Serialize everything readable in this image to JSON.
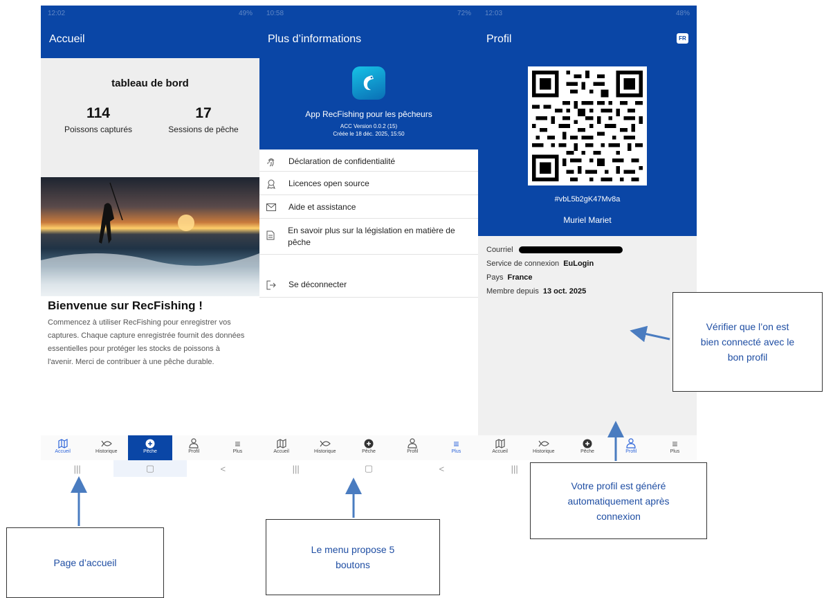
{
  "screen1": {
    "status_time": "12:02",
    "status_right": "49%",
    "title": "Accueil",
    "dashboard": {
      "title": "tableau de bord",
      "stat1_value": "114",
      "stat1_label": "Poissons capturés",
      "stat2_value": "17",
      "stat2_label": "Sessions de pêche"
    },
    "welcome_title": "Bienvenue sur RecFishing !",
    "welcome_text": "Commencez à utiliser RecFishing pour enregistrer vos captures. Chaque capture enregistrée fournit des données essentielles pour protéger les stocks de poissons à l'avenir. Merci de contribuer à une pêche durable."
  },
  "screen2": {
    "status_time": "10:58",
    "status_right": "72%",
    "title": "Plus d’informations",
    "app_title": "App RecFishing pour les pêcheurs",
    "app_version": "ACC Version 0.0.2 (15)",
    "app_date": "Créée le 18 déc. 2025, 15:50",
    "menu": [
      "Déclaration de confidentialité",
      "Licences open source",
      "Aide et assistance",
      "En savoir plus sur la législation en matière de pêche",
      "Se déconnecter"
    ]
  },
  "screen3": {
    "status_time": "12:03",
    "status_right": "48%",
    "title": "Profil",
    "lang_badge": "FR",
    "profile_id": "#vbL5b2gK47Mv8a",
    "profile_name": "Muriel Mariet",
    "email_label": "Courriel",
    "service_label": "Service de connexion",
    "service_value": "EuLogin",
    "country_label": "Pays",
    "country_value": "France",
    "member_label": "Membre depuis",
    "member_value": "13 oct. 2025"
  },
  "nav": {
    "accueil": "Accueil",
    "historique": "Historique",
    "peche": "Pêche",
    "profil": "Profil",
    "plus": "Plus"
  },
  "callouts": {
    "c1": "Page d’accueil",
    "c2_line1": "Le menu propose 5",
    "c2_line2": "boutons",
    "c3_line1": "Vérifier que l’on est",
    "c3_line2": "bien connecté avec le",
    "c3_line3": "bon profil",
    "c4_line1": "Votre profil est généré",
    "c4_line2": "automatiquement après",
    "c4_line3": "connexion"
  },
  "colors": {
    "primary": "#0a46a6",
    "accent": "#2b63d9",
    "callout_text": "#1f4ea3",
    "arrow": "#4a7cc0"
  }
}
